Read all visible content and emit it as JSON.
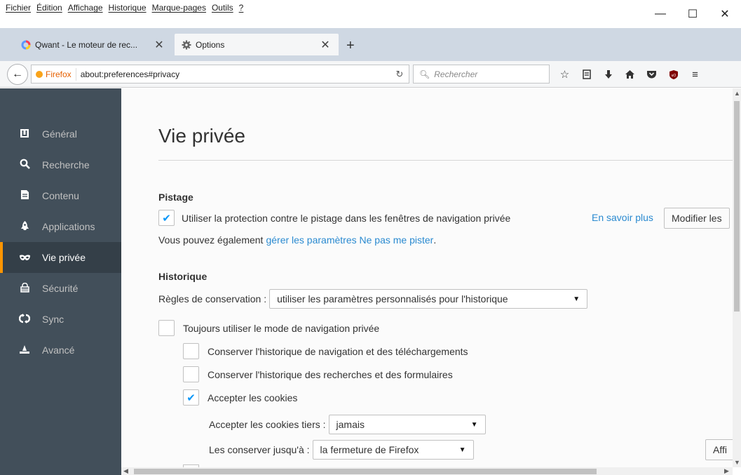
{
  "menu": [
    "Fichier",
    "Édition",
    "Affichage",
    "Historique",
    "Marque-pages",
    "Outils",
    "?"
  ],
  "window_controls": {
    "minimize": "—",
    "maximize": "☐",
    "close": "✕"
  },
  "tabs": [
    {
      "title": "Qwant - Le moteur de rec...",
      "icon": "qwant-icon"
    },
    {
      "title": "Options",
      "icon": "gear-icon"
    }
  ],
  "newtab_label": "+",
  "nav": {
    "identity": "Firefox",
    "url": "about:preferences#privacy",
    "search_placeholder": "Rechercher"
  },
  "sidebar": {
    "items": [
      {
        "label": "Général",
        "icon": "general-icon"
      },
      {
        "label": "Recherche",
        "icon": "search-icon"
      },
      {
        "label": "Contenu",
        "icon": "document-icon"
      },
      {
        "label": "Applications",
        "icon": "applications-icon"
      },
      {
        "label": "Vie privée",
        "icon": "mask-icon",
        "active": true
      },
      {
        "label": "Sécurité",
        "icon": "security-icon"
      },
      {
        "label": "Sync",
        "icon": "sync-icon"
      },
      {
        "label": "Avancé",
        "icon": "wizard-icon"
      }
    ]
  },
  "page": {
    "title": "Vie privée",
    "tracking": {
      "heading": "Pistage",
      "checkbox_label": "Utiliser la protection contre le pistage dans les fenêtres de navigation privée",
      "checked": true,
      "learn_more": "En savoir plus",
      "modify_button": "Modifier les",
      "dnt_prefix": "Vous pouvez également ",
      "dnt_link": "gérer les paramètres Ne pas me pister",
      "dnt_suffix": "."
    },
    "history": {
      "heading": "Historique",
      "rules_label": "Règles de conservation :",
      "rules_value": "utiliser les paramètres personnalisés pour l'historique",
      "always_private": {
        "label": "Toujours utiliser le mode de navigation privée",
        "checked": false
      },
      "keep_browsing": {
        "label": "Conserver l'historique de navigation et des téléchargements",
        "checked": false
      },
      "keep_search": {
        "label": "Conserver l'historique des recherches et des formulaires",
        "checked": false
      },
      "accept_cookies": {
        "label": "Accepter les cookies",
        "checked": true
      },
      "third_party_label": "Accepter les cookies tiers :",
      "third_party_value": "jamais",
      "keep_until_label": "Les conserver jusqu'à :",
      "keep_until_value": "la fermeture de Firefox",
      "show_cookies_button": "Affi"
    }
  }
}
